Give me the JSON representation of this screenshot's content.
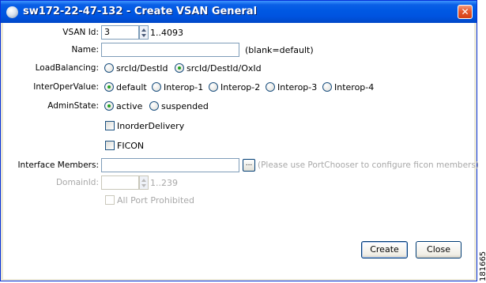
{
  "window": {
    "title": "sw172-22-47-132 - Create VSAN General",
    "close_glyph": "✕"
  },
  "form": {
    "vsan_id": {
      "label": "VSAN Id:",
      "value": "3",
      "range": "1..4093"
    },
    "name": {
      "label": "Name:",
      "value": "",
      "hint": "(blank=default)"
    },
    "load_balancing": {
      "label": "LoadBalancing:",
      "options": [
        "srcId/DestId",
        "srcId/DestId/OxId"
      ],
      "selected": "srcId/DestId/OxId"
    },
    "interop_value": {
      "label": "InterOperValue:",
      "options": [
        "default",
        "Interop-1",
        "Interop-2",
        "Interop-3",
        "Interop-4"
      ],
      "selected": "default"
    },
    "admin_state": {
      "label": "AdminState:",
      "options": [
        "active",
        "suspended"
      ],
      "selected": "active"
    },
    "inorder_delivery": {
      "label": "InorderDelivery",
      "checked": false
    },
    "ficon": {
      "label": "FICON",
      "checked": false
    },
    "interface_members": {
      "label": "Interface Members:",
      "value": "",
      "browse_label": "...",
      "hint": "(Please use PortChooser to configure ficon members)"
    },
    "domain_id": {
      "label": "DomainId:",
      "value": "",
      "range": "1..239",
      "enabled": false
    },
    "all_port_prohibited": {
      "label": "All Port Prohibited",
      "checked": false,
      "enabled": false
    }
  },
  "buttons": {
    "create": "Create",
    "close": "Close"
  },
  "figure_id": "181665",
  "colors": {
    "titlebar": "#0054e0",
    "radio_dot": "#21a121",
    "disabled_text": "#a8a8a8"
  }
}
